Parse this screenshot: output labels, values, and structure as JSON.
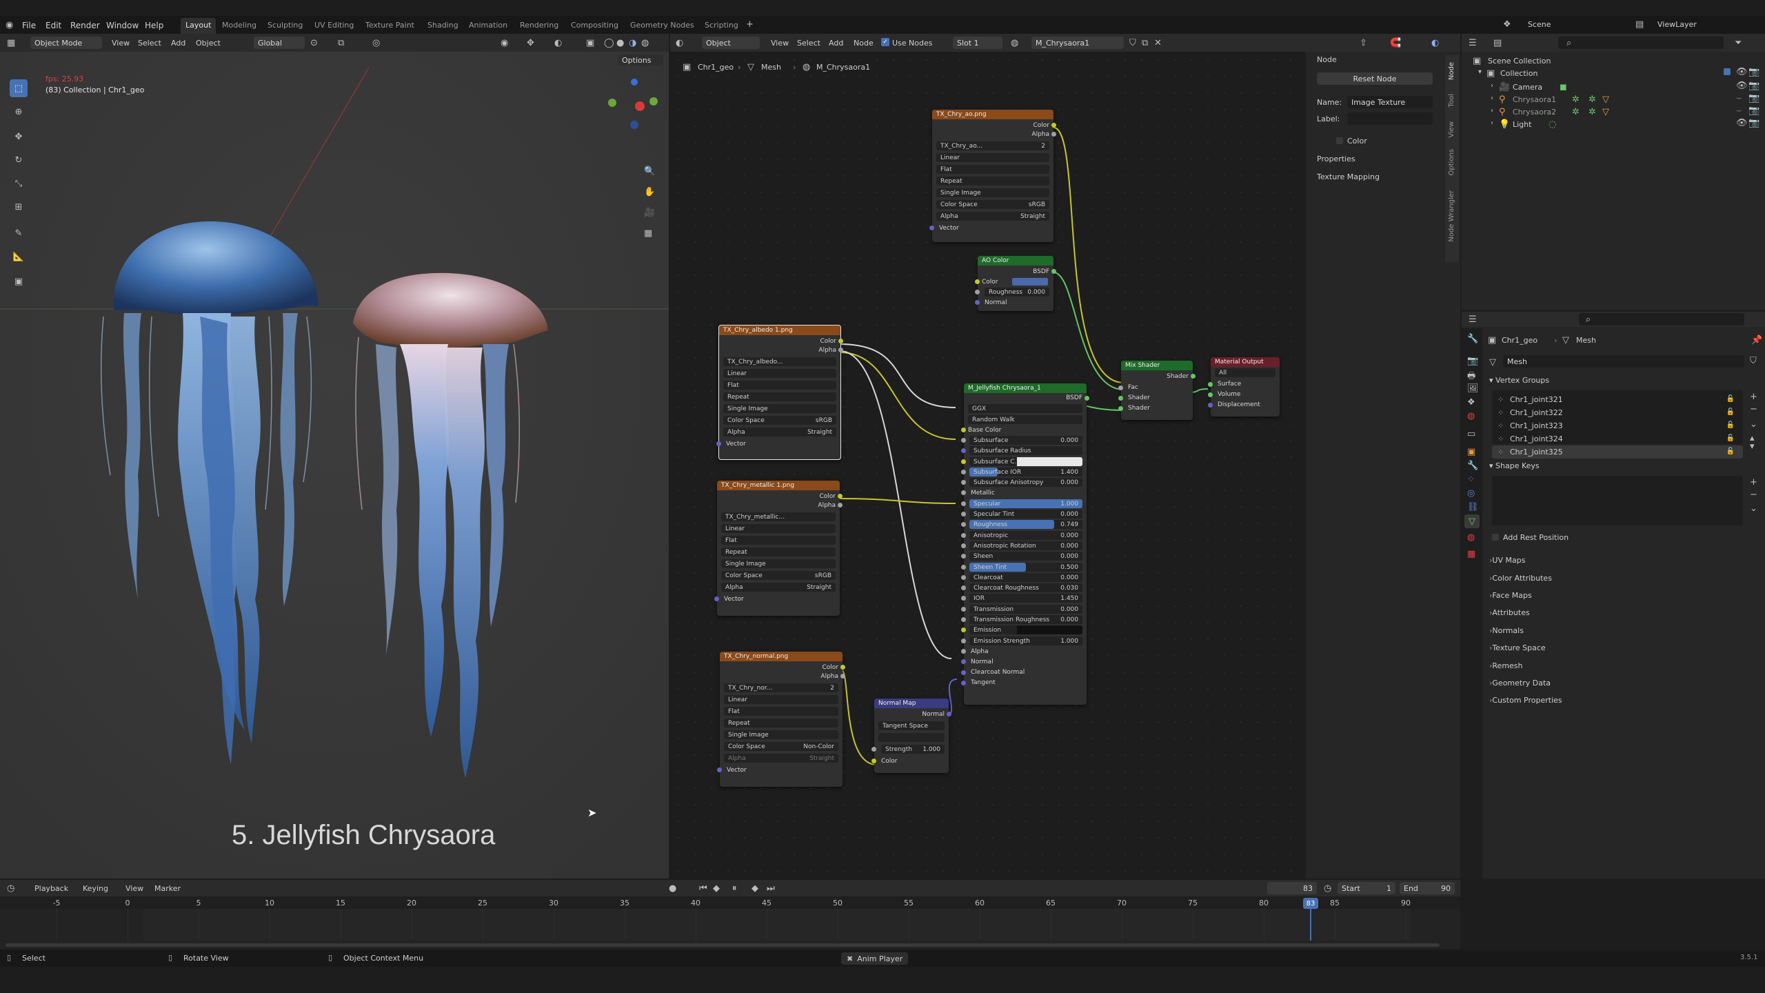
{
  "topbar": {
    "menus": [
      "File",
      "Edit",
      "Render",
      "Window",
      "Help"
    ],
    "workspaces": [
      "Layout",
      "Modeling",
      "Sculpting",
      "UV Editing",
      "Texture Paint",
      "Shading",
      "Animation",
      "Rendering",
      "Compositing",
      "Geometry Nodes",
      "Scripting"
    ],
    "active_workspace": "Layout",
    "scene_label": "Scene",
    "viewlayer_label": "ViewLayer"
  },
  "viewport": {
    "mode": "Object Mode",
    "menus": [
      "View",
      "Select",
      "Add",
      "Object"
    ],
    "orientation": "Global",
    "options_label": "Options",
    "fps": "fps: 25.93",
    "collection_info": "(83) Collection | Chr1_geo",
    "caption": "5. Jellyfish Chrysaora"
  },
  "node_editor": {
    "type": "Object",
    "menus": [
      "View",
      "Select",
      "Add",
      "Node"
    ],
    "use_nodes_label": "Use Nodes",
    "slot": "Slot 1",
    "material": "M_Chrysaora1",
    "breadcrumb": [
      "Chr1_geo",
      "Mesh",
      "M_Chrysaora1"
    ],
    "image_node_rows": [
      "Linear",
      "Flat",
      "Repeat",
      "Single Image"
    ],
    "color_space_label": "Color Space",
    "alpha_label": "Alpha",
    "vector_label": "Vector",
    "color_out": "Color",
    "alpha_out": "Alpha",
    "straight": "Straight",
    "srgb": "sRGB",
    "noncolor": "Non-Color",
    "tex_ao": {
      "title": "TX_Chry_ao.png",
      "image": "TX_Chry_ao...",
      "users": "2"
    },
    "tex_albedo": {
      "title": "TX_Chry_albedo 1.png",
      "image": "TX_Chry_albedo..."
    },
    "tex_metallic": {
      "title": "TX_Chry_metallic 1.png",
      "image": "TX_Chry_metallic..."
    },
    "tex_normal": {
      "title": "TX_Chry_normal.png",
      "image": "TX_Chry_nor...",
      "users": "2"
    },
    "ao_color": {
      "title": "AO Color",
      "out": "BSDF",
      "color": "Color",
      "roughness": "Roughness",
      "roughness_val": "0.000",
      "normal": "Normal"
    },
    "normal_map": {
      "title": "Normal Map",
      "out": "Normal",
      "space": "Tangent Space",
      "strength": "Strength",
      "strength_val": "1.000",
      "color": "Color"
    },
    "mix": {
      "title": "Mix Shader",
      "out": "Shader",
      "fac": "Fac",
      "shader1": "Shader",
      "shader2": "Shader"
    },
    "output": {
      "title": "Material Output",
      "target": "All",
      "surface": "Surface",
      "volume": "Volume",
      "displacement": "Displacement"
    },
    "bsdf": {
      "title": "M_Jellyfish Chrysaora_1",
      "out": "BSDF",
      "dist": "GGX",
      "sss": "Random Walk",
      "base_color": "Base Color",
      "rows": [
        {
          "label": "Subsurface",
          "val": "0.000"
        },
        {
          "label": "Subsurface Radius",
          "val": ""
        },
        {
          "label": "Subsurface C...",
          "val": ""
        },
        {
          "label": "Subsurface IOR",
          "val": "1.400"
        },
        {
          "label": "Subsurface Anisotropy",
          "val": "0.000"
        },
        {
          "label": "Metallic",
          "val": ""
        },
        {
          "label": "Specular",
          "val": "1.000"
        },
        {
          "label": "Specular Tint",
          "val": "0.000"
        },
        {
          "label": "Roughness",
          "val": "0.749"
        },
        {
          "label": "Anisotropic",
          "val": "0.000"
        },
        {
          "label": "Anisotropic Rotation",
          "val": "0.000"
        },
        {
          "label": "Sheen",
          "val": "0.000"
        },
        {
          "label": "Sheen Tint",
          "val": "0.500"
        },
        {
          "label": "Clearcoat",
          "val": "0.000"
        },
        {
          "label": "Clearcoat Roughness",
          "val": "0.030"
        },
        {
          "label": "IOR",
          "val": "1.450"
        },
        {
          "label": "Transmission",
          "val": "0.000"
        },
        {
          "label": "Transmission Roughness",
          "val": "0.000"
        },
        {
          "label": "Emission",
          "val": ""
        },
        {
          "label": "Emission Strength",
          "val": "1.000"
        },
        {
          "label": "Alpha",
          "val": ""
        },
        {
          "label": "Normal",
          "val": ""
        },
        {
          "label": "Clearcoat Normal",
          "val": ""
        },
        {
          "label": "Tangent",
          "val": ""
        }
      ]
    }
  },
  "node_sidebar": {
    "section": "Node",
    "reset": "Reset Node",
    "name_label": "Name:",
    "name_val": "Image Texture",
    "label_label": "Label:",
    "color": "Color",
    "properties": "Properties",
    "texture_mapping": "Texture Mapping",
    "tabs": [
      "Node",
      "Tool",
      "View",
      "Options",
      "Node Wrangler"
    ]
  },
  "outliner": {
    "root": "Scene Collection",
    "collection": "Collection",
    "items": [
      "Camera",
      "Chrysaora1",
      "Chrysaora2",
      "Light"
    ]
  },
  "properties": {
    "breadcrumb": [
      "Chr1_geo",
      "Mesh"
    ],
    "mesh_name": "Mesh",
    "vertex_groups": "Vertex Groups",
    "groups": [
      "Chr1_joint321",
      "Chr1_joint322",
      "Chr1_joint323",
      "Chr1_joint324",
      "Chr1_joint325"
    ],
    "shape_keys": "Shape Keys",
    "add_rest": "Add Rest Position",
    "sections": [
      "UV Maps",
      "Color Attributes",
      "Face Maps",
      "Attributes",
      "Normals",
      "Texture Space",
      "Remesh",
      "Geometry Data",
      "Custom Properties"
    ]
  },
  "timeline": {
    "menus": [
      "Playback",
      "Keying",
      "View",
      "Marker"
    ],
    "current_frame": "83",
    "start_label": "Start",
    "start": "1",
    "end_label": "End",
    "end": "90",
    "ticks": [
      "-5",
      "0",
      "5",
      "10",
      "15",
      "20",
      "25",
      "30",
      "35",
      "40",
      "45",
      "50",
      "55",
      "60",
      "65",
      "70",
      "75",
      "80",
      "85",
      "90"
    ]
  },
  "statusbar": {
    "select": "Select",
    "rotate": "Rotate View",
    "context": "Object Context Menu",
    "anim": "Anim Player",
    "version": "3.5.1"
  }
}
